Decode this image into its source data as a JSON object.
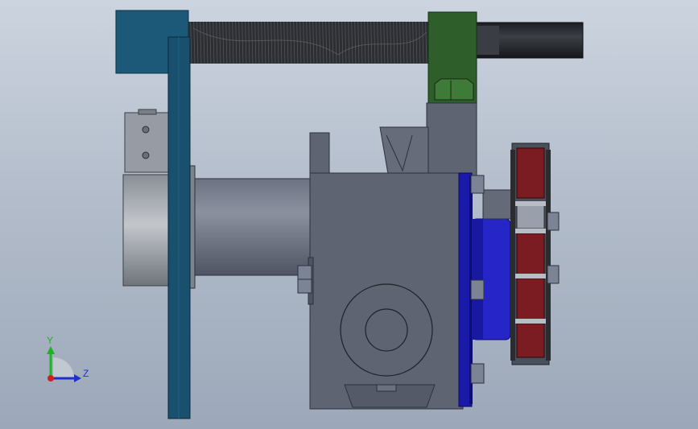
{
  "viewport": {
    "background_top": "#ccd4df",
    "background_bottom": "#9ca8b9"
  },
  "triad": {
    "y_label": "Y",
    "z_label": "Z",
    "y_color": "#1fb41f",
    "z_color": "#2030d0",
    "x_color": "#d02020"
  },
  "colors": {
    "housing": "#5e6472",
    "housing_dark": "#4b515e",
    "belt_plate": "#18506e",
    "bearing_block": "#1c5878",
    "threaded_rod": "#2a2c30",
    "green_block": "#2e5e2a",
    "motor_flange": "#1a1aa8",
    "motor_body": "#2626c8",
    "chain_red": "#7a1c22",
    "shaft_grey": "#6e7482",
    "clamp": "#a7acb3",
    "bolt": "#7a8494",
    "shaft_end": "#2b2d33"
  }
}
